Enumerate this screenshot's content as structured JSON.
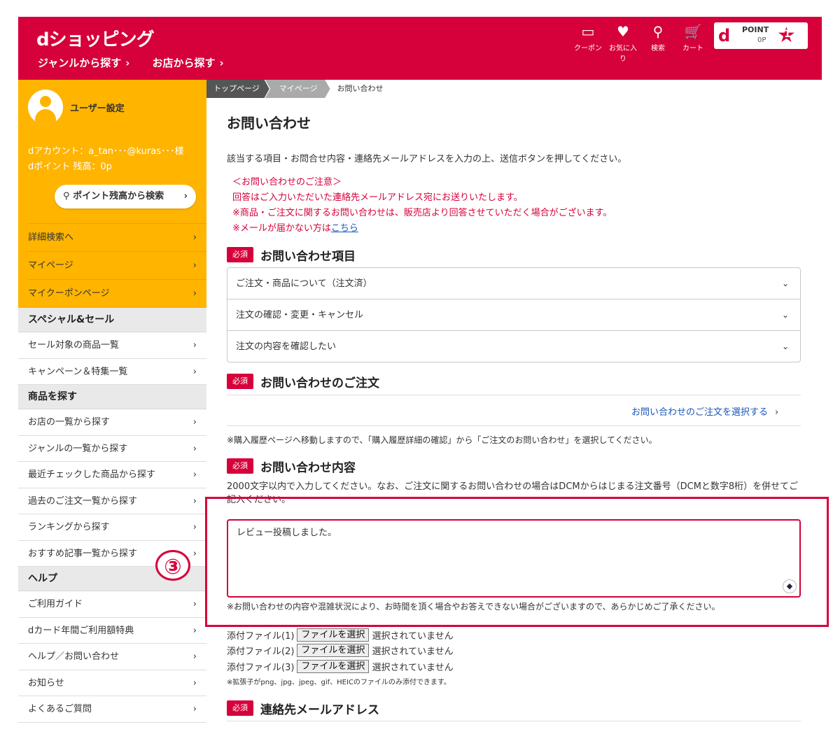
{
  "header": {
    "logo": "dショッピング",
    "nav": [
      {
        "label": "ジャンルから探す",
        "chevron": "›"
      },
      {
        "label": "お店から探す",
        "chevron": "›"
      }
    ],
    "icons": [
      {
        "label": "クーポン",
        "glyph": "▭",
        "icon": "coupon-icon"
      },
      {
        "label": "お気に入り",
        "glyph": "♥",
        "icon": "heart-icon"
      },
      {
        "label": "検索",
        "glyph": "⚲",
        "icon": "search-icon"
      },
      {
        "label": "カート",
        "glyph": "🛒",
        "icon": "cart-icon"
      }
    ],
    "dpoint": {
      "logo": "d",
      "label": "POINT",
      "value": "0P",
      "rank": "1"
    }
  },
  "sidebar": {
    "user_label": "ユーザー設定",
    "account_line": "dアカウント：a_tan･･･@kuras･･･様",
    "points_line": "dポイント 残高：0p",
    "point_search": "ポイント残高から検索",
    "yellow_items": [
      "詳細検索へ",
      "マイページ",
      "マイクーポンページ"
    ],
    "sections": [
      {
        "title": "スペシャル&セール",
        "items": [
          "セール対象の商品一覧",
          "キャンペーン＆特集一覧"
        ]
      },
      {
        "title": "商品を探す",
        "items": [
          "お店の一覧から探す",
          "ジャンルの一覧から探す",
          "最近チェックした商品から探す",
          "過去のご注文一覧から探す",
          "ランキングから探す",
          "おすすめ記事一覧から探す"
        ]
      },
      {
        "title": "ヘルプ",
        "items": [
          "ご利用ガイド",
          "dカード年間ご利用額特典",
          "ヘルプ／お問い合わせ",
          "お知らせ",
          "よくあるご質問"
        ]
      }
    ],
    "step_badge": "③"
  },
  "breadcrumb": [
    "トップページ",
    "マイページ",
    "お問い合わせ"
  ],
  "main": {
    "title": "お問い合わせ",
    "intro": "該当する項目・お問合せ内容・連絡先メールアドレスを入力の上、送信ボタンを押してください。",
    "notice": {
      "heading": "＜お問い合わせのご注意＞",
      "line1": "回答はご入力いただいた連絡先メールアドレス宛にお送りいたします。",
      "line2": "※商品・ご注文に関するお問い合わせは、販売店より回答させていただく場合がございます。",
      "line3_prefix": "※メールが届かない方は",
      "line3_link": "こちら"
    },
    "required_label": "必須",
    "section_item": "お問い合わせ項目",
    "selects": [
      "ご注文・商品について（注文済）",
      "注文の確認・変更・キャンセル",
      "注文の内容を確認したい"
    ],
    "section_order": "お問い合わせのご注文",
    "order_link": "お問い合わせのご注文を選択する",
    "order_note": "※購入履歴ページへ移動しますので、「購入履歴詳細の確認」から「ご注文のお問い合わせ」を選択してください。",
    "section_content": "お問い合わせ内容",
    "content_desc": "2000文字以内で入力してください。なお、ご注文に関するお問い合わせの場合はDCMからはじまる注文番号（DCMと数字8桁）を併せてご記入ください。",
    "content_value": "レビュー投稿しました。",
    "content_note": "※お問い合わせの内容や混雑状況により、お時間を頂く場合やお答えできない場合がございますので、あらかじめご了承ください。",
    "files": [
      {
        "label": "添付ファイル(1)",
        "button": "ファイルを選択",
        "status": "選択されていません"
      },
      {
        "label": "添付ファイル(2)",
        "button": "ファイルを選択",
        "status": "選択されていません"
      },
      {
        "label": "添付ファイル(3)",
        "button": "ファイルを選択",
        "status": "選択されていません"
      }
    ],
    "file_ext_note": "※拡張子がpng、jpg、jpeg、gif、HEICのファイルのみ添付できます。",
    "section_email": "連絡先メールアドレス"
  },
  "colors": {
    "brand": "#d6003a",
    "sidebar_accent": "#ffb400",
    "link": "#1a56b5"
  }
}
